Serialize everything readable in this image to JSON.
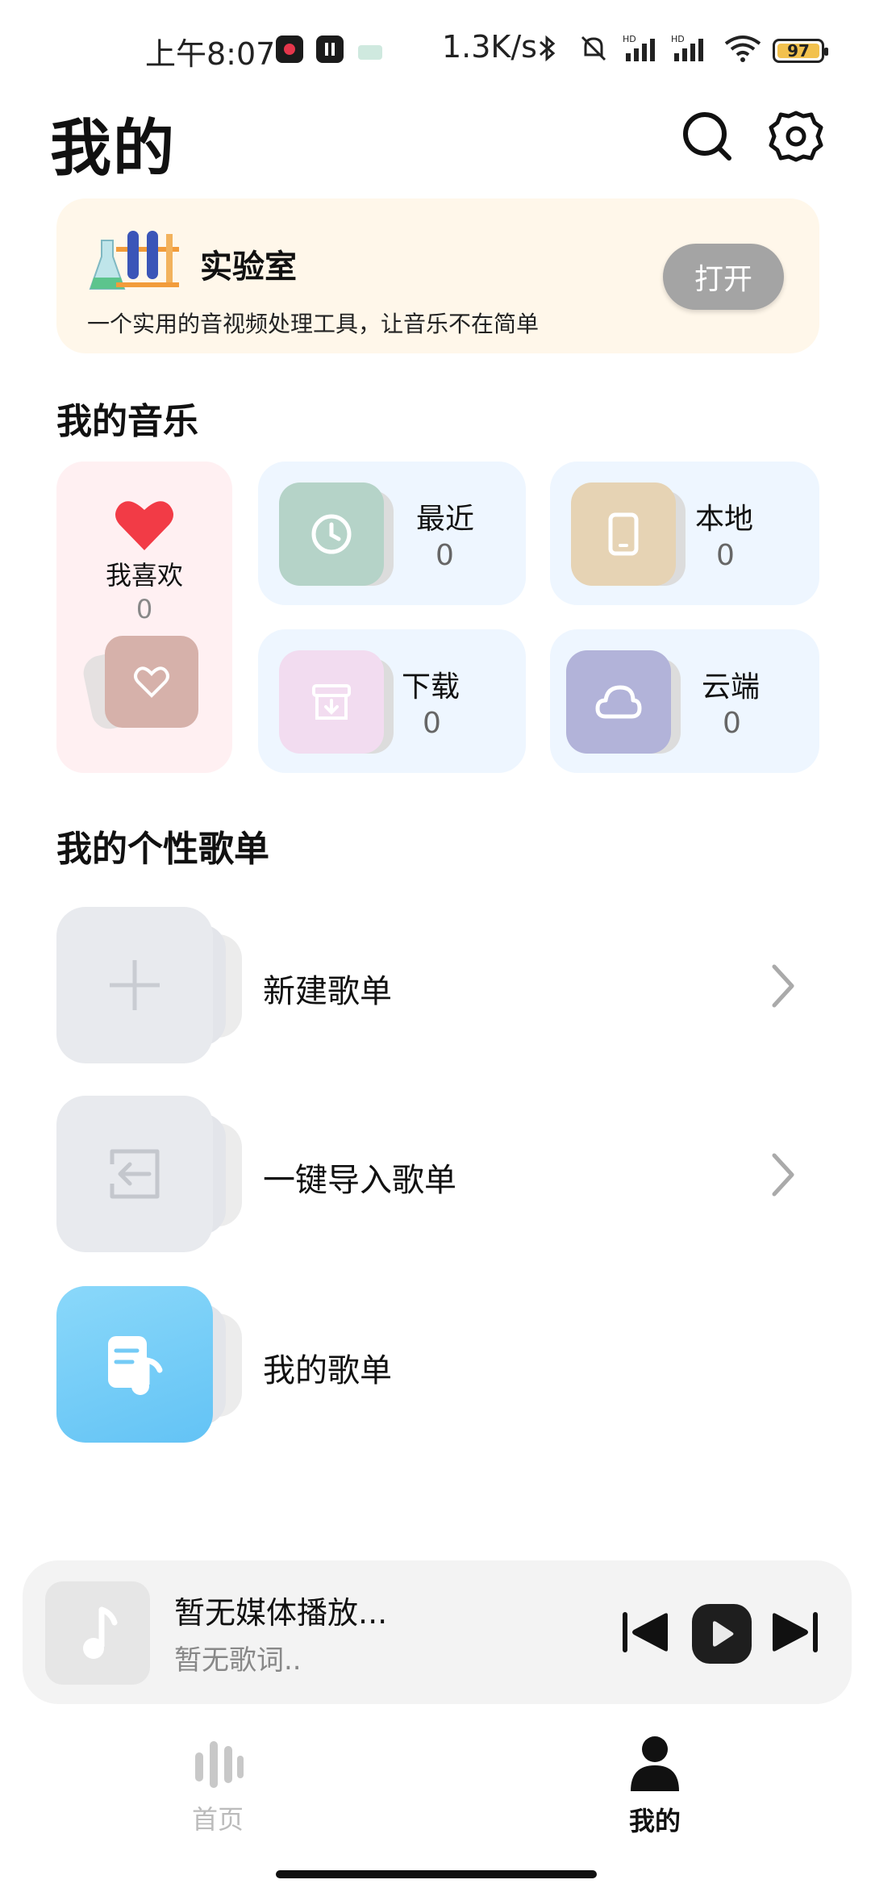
{
  "status_bar": {
    "time": "上午8:07",
    "net_speed": "1.3K/s",
    "battery": "97"
  },
  "header": {
    "title": "我的",
    "search_icon": "search-icon",
    "settings_icon": "gear-icon"
  },
  "lab": {
    "name": "实验室",
    "description": "一个实用的音视频处理工具，让音乐不在简单",
    "button": "打开"
  },
  "my_music": {
    "section_title": "我的音乐",
    "favorite": {
      "label": "我喜欢",
      "count": "0"
    },
    "tiles": [
      {
        "label": "最近",
        "count": "0",
        "icon": "clock-icon",
        "color": "#b5d3c8"
      },
      {
        "label": "本地",
        "count": "0",
        "icon": "phone-icon",
        "color": "#e6d3b4"
      },
      {
        "label": "下载",
        "count": "0",
        "icon": "download-box-icon",
        "color": "#f2dcf0"
      },
      {
        "label": "云端",
        "count": "0",
        "icon": "cloud-icon",
        "color": "#b2b3d9"
      }
    ]
  },
  "playlists": {
    "section_title": "我的个性歌单",
    "items": [
      {
        "label": "新建歌单",
        "icon": "plus-icon"
      },
      {
        "label": "一键导入歌单",
        "icon": "import-icon"
      },
      {
        "label": "我的歌单",
        "icon": "music-note-doc-icon"
      }
    ]
  },
  "player": {
    "title": "暂无媒体播放...",
    "subtitle": "暂无歌词.."
  },
  "bottom_nav": {
    "home": "首页",
    "mine": "我的"
  }
}
